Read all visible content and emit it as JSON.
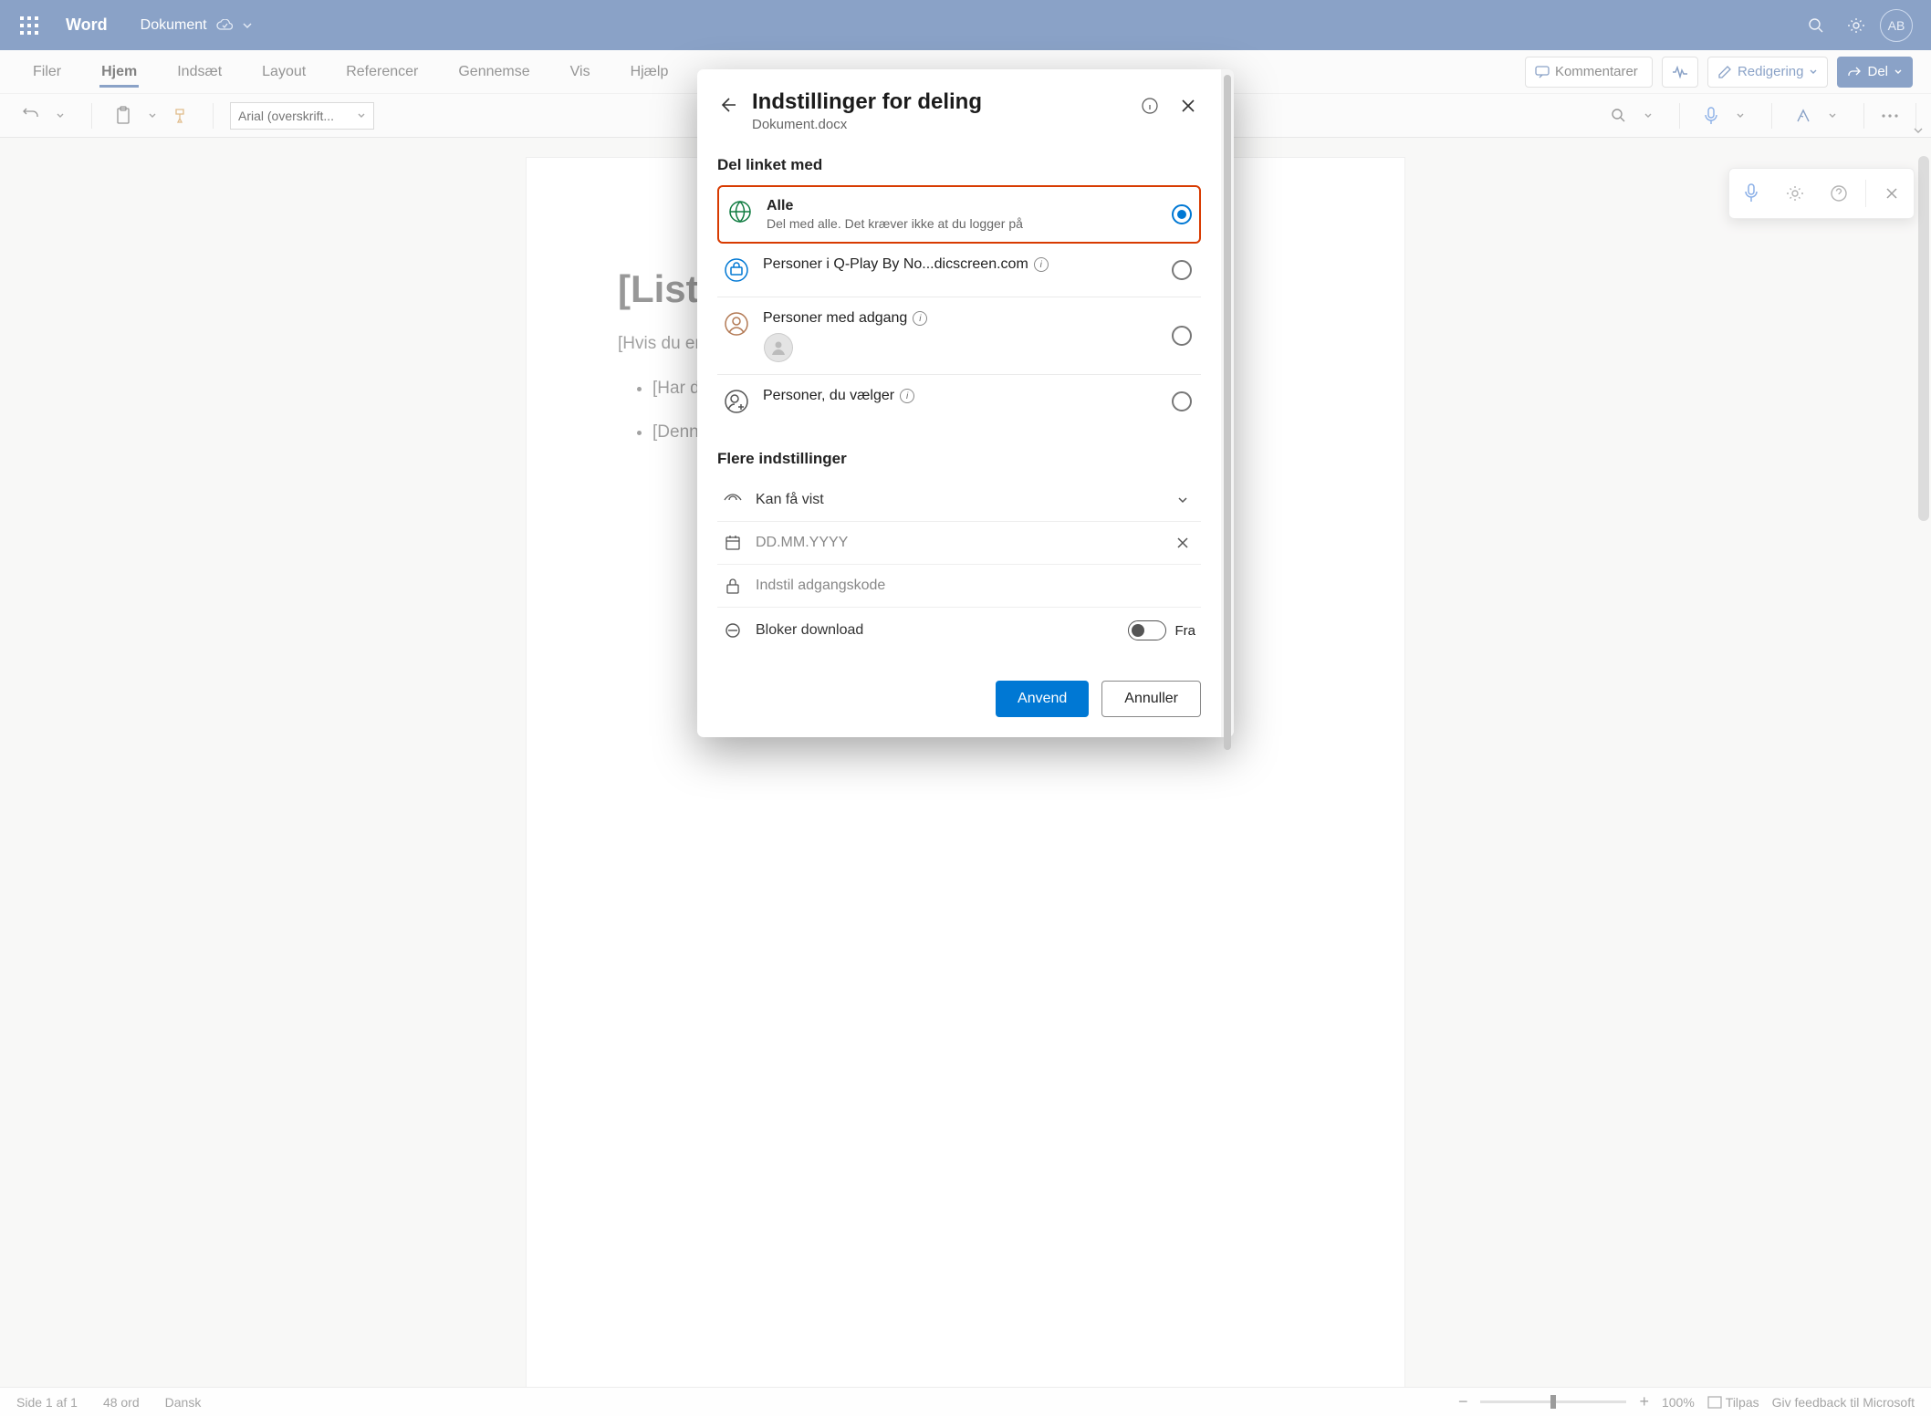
{
  "titlebar": {
    "app_name": "Word",
    "document_name": "Dokument",
    "avatar_initials": "AB"
  },
  "ribbon_tabs": {
    "items": [
      "Filer",
      "Hjem",
      "Indsæt",
      "Layout",
      "Referencer",
      "Gennemse",
      "Vis",
      "Hjælp"
    ],
    "active_index": 1,
    "comment_btn": "Kommentarer",
    "edit_btn": "Redigering",
    "share_btn": "Del"
  },
  "ribbon": {
    "font_name": "Arial (overskrift..."
  },
  "document": {
    "title": "[Liste",
    "subtitle": "[Hvis du er klar til at skrive, skal du blot markere en tekstlinje og begynde",
    "list_items": [
      "[Har du brug for en overskrift? Klik på den ønskede overs",
      "[Denne"
    ]
  },
  "statusbar": {
    "page_info": "Side 1 af 1",
    "word_count": "48 ord",
    "language": "Dansk",
    "zoom_pct": "100%",
    "fit": "Tilpas",
    "feedback": "Giv feedback til Microsoft"
  },
  "modal": {
    "title": "Indstillinger for deling",
    "subtitle": "Dokument.docx",
    "section1_label": "Del linket med",
    "options": [
      {
        "title": "Alle",
        "desc": "Del med alle. Det kræver ikke at du logger på",
        "selected": true,
        "bold": true,
        "icon": "globe",
        "info": false
      },
      {
        "title": "Personer i Q-Play By No...dicscreen.com",
        "desc": "",
        "selected": false,
        "bold": false,
        "icon": "briefcase",
        "info": true
      },
      {
        "title": "Personer med adgang",
        "desc": "",
        "selected": false,
        "bold": false,
        "icon": "personcircle",
        "info": true,
        "has_avatar": true
      },
      {
        "title": "Personer, du vælger",
        "desc": "",
        "selected": false,
        "bold": false,
        "icon": "personplus",
        "info": true
      }
    ],
    "section2_label": "Flere indstillinger",
    "permission_label": "Kan få vist",
    "date_placeholder": "DD.MM.YYYY",
    "password_placeholder": "Indstil adgangskode",
    "block_download_label": "Bloker download",
    "block_download_state": "Fra",
    "apply_label": "Anvend",
    "cancel_label": "Annuller"
  }
}
